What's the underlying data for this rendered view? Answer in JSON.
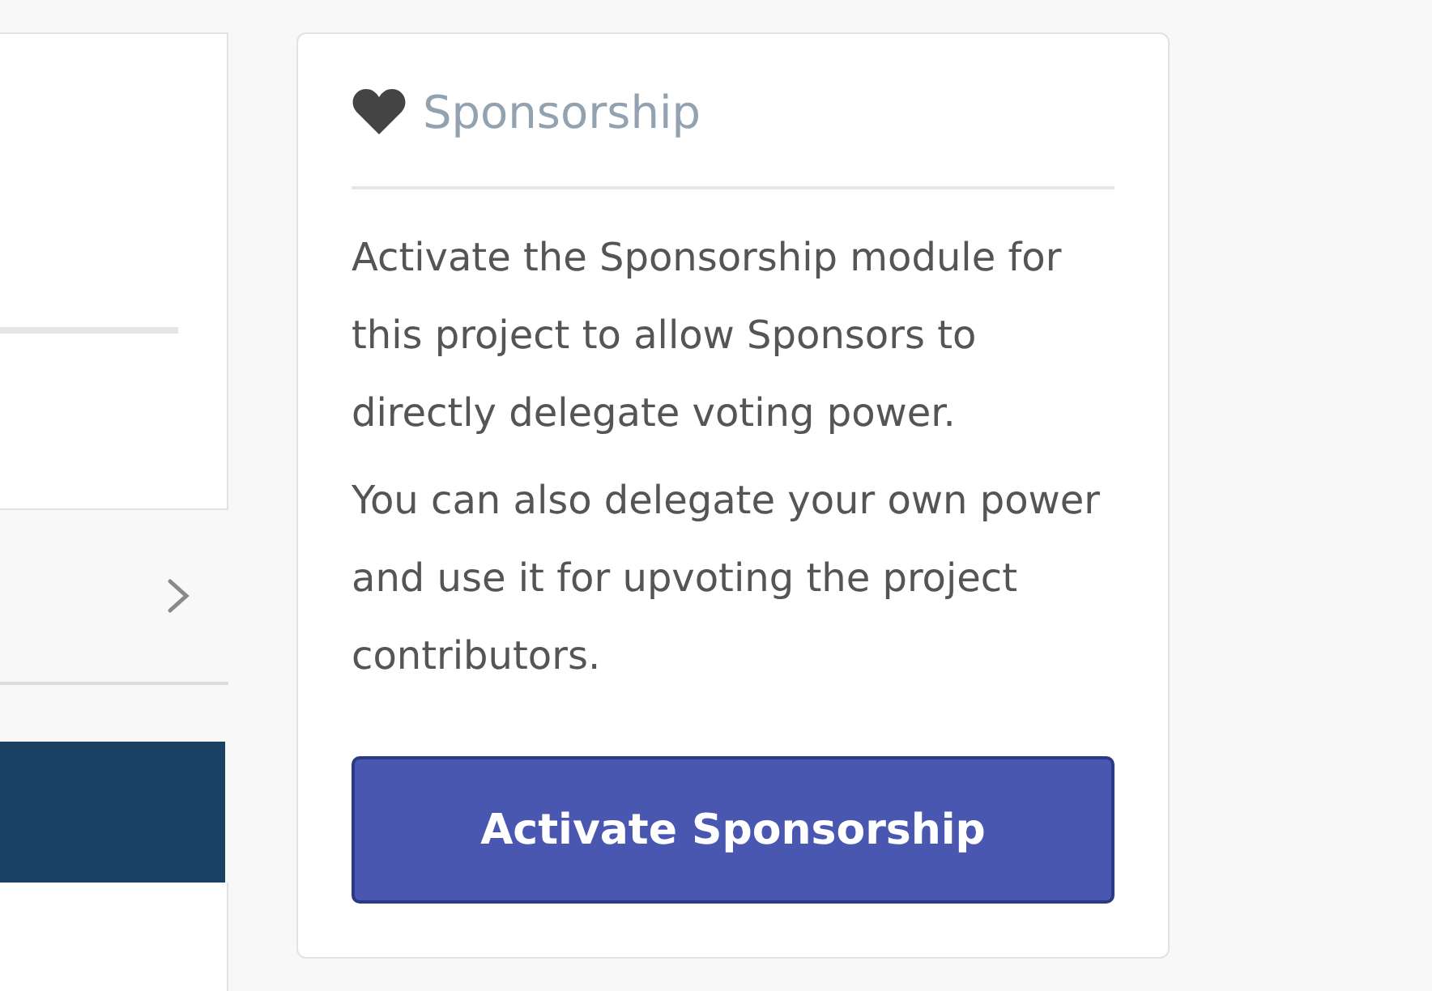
{
  "sponsorship_card": {
    "title": "Sponsorship",
    "paragraphs": [
      "Activate the Sponsorship module for this project to allow Sponsors to directly delegate voting power.",
      "You can also delegate your own power and use it for upvoting the project contributors."
    ],
    "button": "Activate Sponsorship"
  }
}
